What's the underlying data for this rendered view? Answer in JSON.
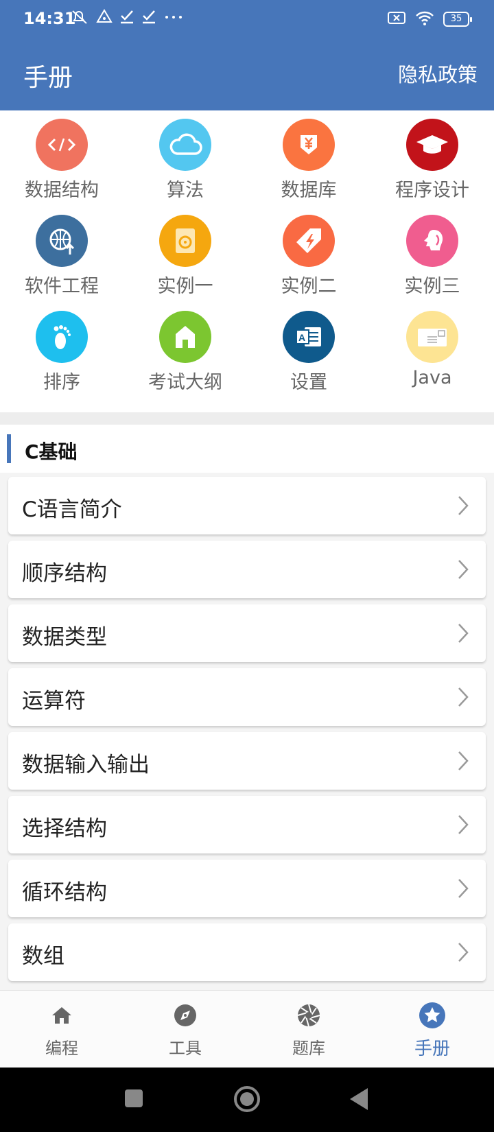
{
  "status": {
    "time": "14:31",
    "battery": "35"
  },
  "header": {
    "title": "手册",
    "privacy_label": "隐私政策"
  },
  "grid": [
    {
      "label": "数据结构",
      "icon": "code-icon",
      "color": "#f0735f"
    },
    {
      "label": "算法",
      "icon": "cloud-icon",
      "color": "#53c7f0"
    },
    {
      "label": "数据库",
      "icon": "yen-download-icon",
      "color": "#fa7440"
    },
    {
      "label": "程序设计",
      "icon": "graduation-cap-icon",
      "color": "#c2131a"
    },
    {
      "label": "软件工程",
      "icon": "globe-upload-icon",
      "color": "#3d6f9e"
    },
    {
      "label": "实例一",
      "icon": "disk-icon",
      "color": "#f5a70f"
    },
    {
      "label": "实例二",
      "icon": "tag-bolt-icon",
      "color": "#f96a43"
    },
    {
      "label": "实例三",
      "icon": "profile-icon",
      "color": "#f05d8f"
    },
    {
      "label": "排序",
      "icon": "footprint-icon",
      "color": "#1ebfee"
    },
    {
      "label": "考试大纲",
      "icon": "home-icon",
      "color": "#7cc630"
    },
    {
      "label": "设置",
      "icon": "database-doc-icon",
      "color": "#0f5a8c"
    },
    {
      "label": "Java",
      "icon": "envelope-icon",
      "color": "#fde493"
    }
  ],
  "section": {
    "title": "C基础"
  },
  "list": [
    {
      "label": "C语言简介"
    },
    {
      "label": "顺序结构"
    },
    {
      "label": "数据类型"
    },
    {
      "label": "运算符"
    },
    {
      "label": "数据输入输出"
    },
    {
      "label": "选择结构"
    },
    {
      "label": "循环结构"
    },
    {
      "label": "数组"
    }
  ],
  "nav": [
    {
      "label": "编程",
      "icon": "home-icon",
      "active": false
    },
    {
      "label": "工具",
      "icon": "compass-icon",
      "active": false
    },
    {
      "label": "题库",
      "icon": "aperture-icon",
      "active": false
    },
    {
      "label": "手册",
      "icon": "star-icon",
      "active": true
    }
  ],
  "colors": {
    "primary": "#4776ba",
    "background": "#f4f4f4"
  }
}
